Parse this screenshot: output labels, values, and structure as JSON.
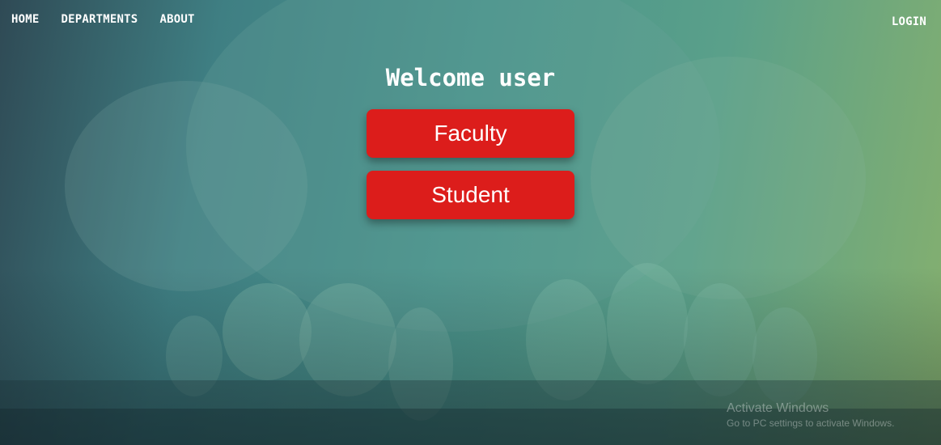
{
  "nav": {
    "home": "HOME",
    "departments": "DEPARTMENTS",
    "about": "ABOUT",
    "login": "LOGIN"
  },
  "main": {
    "title": "Welcome user",
    "faculty_label": "Faculty",
    "student_label": "Student"
  },
  "watermark": {
    "title": "Activate Windows",
    "subtitle": "Go to PC settings to activate Windows."
  },
  "colors": {
    "button_bg": "#dc1d1b",
    "text": "#ffffff"
  }
}
